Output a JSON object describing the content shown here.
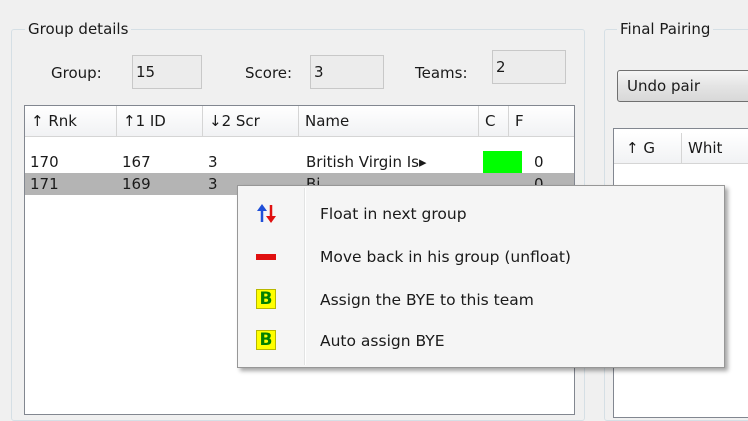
{
  "group_details": {
    "title": "Group details",
    "group_label": "Group:",
    "group_value": "15",
    "score_label": "Score:",
    "score_value": "3",
    "teams_label": "Teams:",
    "teams_value": "2",
    "columns": [
      "↑ Rnk",
      "↑1 ID",
      "↓2 Scr",
      "Name",
      "C",
      "F"
    ],
    "rows": [
      {
        "rnk": "170",
        "id": "167",
        "scr": "3",
        "name": "British Virgin Is▸",
        "c_color": "#00ff00",
        "f": "0"
      },
      {
        "rnk": "171",
        "id": "169",
        "scr": "3",
        "name": "Bi",
        "c_color": "",
        "f": "0"
      }
    ]
  },
  "final_pairings": {
    "title": "Final Pairing",
    "undo_button": "Undo pair",
    "columns": [
      "↑ G",
      "Whit"
    ]
  },
  "context_menu": {
    "items": [
      {
        "label": "Float in next group",
        "icon": "float-arrows-icon"
      },
      {
        "label": "Move back in his group (unfloat)",
        "icon": "minus-icon"
      },
      {
        "label": "Assign the BYE to this team",
        "icon": "bye-icon",
        "icon_text": "B"
      },
      {
        "label": "Auto assign BYE",
        "icon": "auto-bye-icon",
        "icon_text": "B"
      }
    ]
  },
  "colors": {
    "c_cell_green": "#00ff00",
    "arrow_blue": "#1f4fd8",
    "arrow_red": "#e01010",
    "bye_yellow": "#ffff00",
    "bye_green": "#008000"
  }
}
